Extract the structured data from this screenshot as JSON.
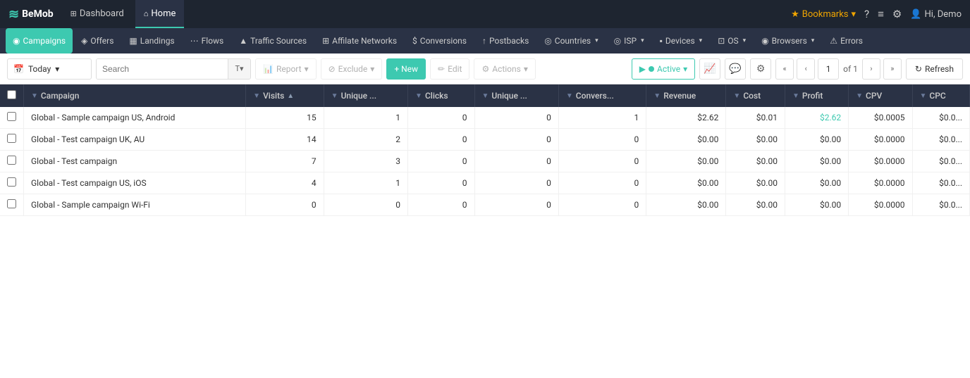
{
  "logo": {
    "icon": "≋",
    "text": "BeMob"
  },
  "top_nav": {
    "tabs": [
      {
        "label": "Dashboard",
        "icon": "⊞",
        "active": false
      },
      {
        "label": "Home",
        "icon": "⌂",
        "active": true
      }
    ],
    "right": {
      "bookmarks_label": "Bookmarks",
      "help_icon": "?",
      "notification_icon": "≡",
      "settings_icon": "⚙",
      "user_label": "Hi, Demo"
    }
  },
  "second_nav": {
    "items": [
      {
        "label": "Campaigns",
        "icon": "◉",
        "active": true
      },
      {
        "label": "Offers",
        "icon": "◈"
      },
      {
        "label": "Landings",
        "icon": "▦"
      },
      {
        "label": "Flows",
        "icon": "⋯"
      },
      {
        "label": "Traffic Sources",
        "icon": "▲"
      },
      {
        "label": "Affilate Networks",
        "icon": "⊞"
      },
      {
        "label": "Conversions",
        "icon": "$"
      },
      {
        "label": "Postbacks",
        "icon": "↑"
      },
      {
        "label": "Countries",
        "icon": "◎",
        "has_arrow": true
      },
      {
        "label": "ISP",
        "icon": "◎",
        "has_arrow": true
      },
      {
        "label": "Devices",
        "icon": "▪",
        "has_arrow": true
      },
      {
        "label": "OS",
        "icon": "⊡",
        "has_arrow": true
      },
      {
        "label": "Browsers",
        "icon": "◉",
        "has_arrow": true
      },
      {
        "label": "Errors",
        "icon": "⚠"
      }
    ]
  },
  "toolbar": {
    "date_label": "Today",
    "search_placeholder": "Search",
    "filter_label": "T",
    "report_label": "Report",
    "exclude_label": "Exclude",
    "new_label": "+ New",
    "edit_label": "Edit",
    "actions_label": "Actions",
    "active_label": "Active",
    "page_current": "1",
    "page_total": "of 1",
    "refresh_label": "Refresh"
  },
  "table": {
    "columns": [
      {
        "label": "Campaign",
        "filterable": true,
        "sortable": true
      },
      {
        "label": "Visits",
        "filterable": true,
        "sortable": true
      },
      {
        "label": "Unique ...",
        "filterable": true,
        "sortable": false
      },
      {
        "label": "Clicks",
        "filterable": true,
        "sortable": false
      },
      {
        "label": "Unique ...",
        "filterable": true,
        "sortable": false
      },
      {
        "label": "Convers...",
        "filterable": true,
        "sortable": false
      },
      {
        "label": "Revenue",
        "filterable": true,
        "sortable": false
      },
      {
        "label": "Cost",
        "filterable": true,
        "sortable": false
      },
      {
        "label": "Profit",
        "filterable": true,
        "sortable": false
      },
      {
        "label": "CPV",
        "filterable": true,
        "sortable": false
      },
      {
        "label": "CPC",
        "filterable": true,
        "sortable": false
      }
    ],
    "rows": [
      {
        "campaign": "Global - Sample campaign US, Android",
        "visits": "15",
        "unique1": "1",
        "clicks": "0",
        "unique2": "0",
        "conversions": "1",
        "revenue": "$2.62",
        "cost": "$0.01",
        "profit": "$2.62",
        "cpv": "$0.0005",
        "cpc": "$0.0...",
        "profit_green": true
      },
      {
        "campaign": "Global - Test campaign UK, AU",
        "visits": "14",
        "unique1": "2",
        "clicks": "0",
        "unique2": "0",
        "conversions": "0",
        "revenue": "$0.00",
        "cost": "$0.00",
        "profit": "$0.00",
        "cpv": "$0.0000",
        "cpc": "$0.0...",
        "profit_green": false
      },
      {
        "campaign": "Global - Test campaign",
        "visits": "7",
        "unique1": "3",
        "clicks": "0",
        "unique2": "0",
        "conversions": "0",
        "revenue": "$0.00",
        "cost": "$0.00",
        "profit": "$0.00",
        "cpv": "$0.0000",
        "cpc": "$0.0...",
        "profit_green": false
      },
      {
        "campaign": "Global - Test campaign US, iOS",
        "visits": "4",
        "unique1": "1",
        "clicks": "0",
        "unique2": "0",
        "conversions": "0",
        "revenue": "$0.00",
        "cost": "$0.00",
        "profit": "$0.00",
        "cpv": "$0.0000",
        "cpc": "$0.0...",
        "profit_green": false
      },
      {
        "campaign": "Global - Sample campaign Wi-Fi",
        "visits": "0",
        "unique1": "0",
        "clicks": "0",
        "unique2": "0",
        "conversions": "0",
        "revenue": "$0.00",
        "cost": "$0.00",
        "profit": "$0.00",
        "cpv": "$0.0000",
        "cpc": "$0.0...",
        "profit_green": false
      }
    ]
  }
}
